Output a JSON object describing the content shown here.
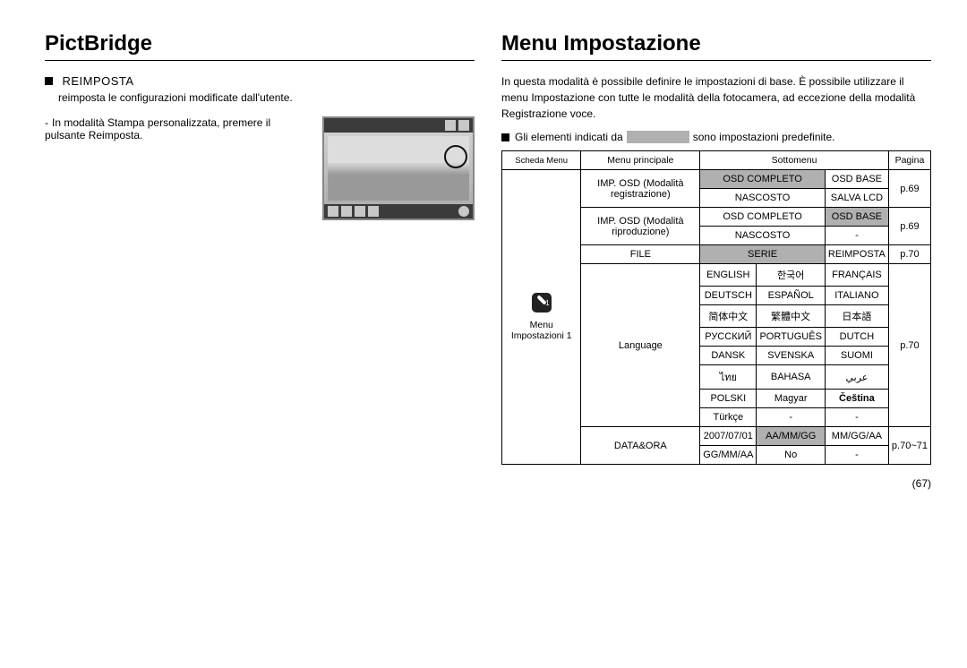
{
  "left": {
    "title": "PictBridge",
    "section": "REIMPOSTA",
    "section_desc": "reimposta le configurazioni modificate dall'utente.",
    "bullet": "In modalità Stampa personalizzata, premere il pulsante Reimposta."
  },
  "right": {
    "title": "Menu Impostazione",
    "intro": "In questa modalità è possibile definire le impostazioni di base. È possibile utilizzare il menu Impostazione con tutte le modalità della fotocamera, ad eccezione della modalità Registrazione voce.",
    "legend_before": "Gli elementi indicati da",
    "legend_after": "sono impostazioni predefinite."
  },
  "table": {
    "headers": {
      "scheda": "Scheda Menu",
      "principale": "Menu principale",
      "sottomenu": "Sottomenu",
      "pagina": "Pagina"
    },
    "tab_label": "Menu Impostazioni 1",
    "rows": {
      "imp_osd_rec": "IMP. OSD (Modalità registrazione)",
      "imp_osd_play": "IMP. OSD (Modalità riproduzione)",
      "osd_completo": "OSD COMPLETO",
      "osd_base": "OSD BASE",
      "nascosto": "NASCOSTO",
      "salva_lcd": "SALVA LCD",
      "file": "FILE",
      "serie": "SERIE",
      "reimposta": "REIMPOSTA",
      "language": "Language",
      "dataora": "DATA&ORA",
      "date_sample": "2007/07/01",
      "aammgg": "AA/MM/GG",
      "mmggaa": "MM/GG/AA",
      "ggmmaa": "GG/MM/AA",
      "no": "No"
    },
    "langs": {
      "english": "ENGLISH",
      "korean": "한국어",
      "francais": "FRANÇAIS",
      "deutsch": "DEUTSCH",
      "espanol": "ESPAÑOL",
      "italiano": "ITALIANO",
      "zhs": "简体中文",
      "zht": "繁體中文",
      "ja": "日本語",
      "russian": "РУССКИЙ",
      "portugues": "PORTUGUÊS",
      "dutch": "DUTCH",
      "dansk": "DANSK",
      "svenska": "SVENSKA",
      "suomi": "SUOMI",
      "thai": "ไทย",
      "bahasa": "BAHASA",
      "arabic": "عربي",
      "polski": "POLSKI",
      "magyar": "Magyar",
      "cestina": "Čeština",
      "turkce": "Türkçe"
    },
    "pages": {
      "p69": "p.69",
      "p70": "p.70",
      "p70_71": "p.70~71"
    }
  },
  "page_number": "(67)"
}
